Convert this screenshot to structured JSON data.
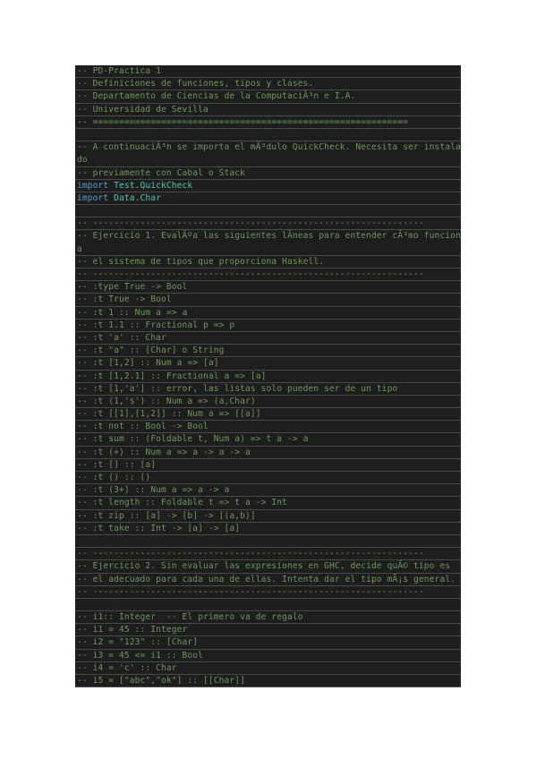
{
  "colors": {
    "background": "#1e1e1e",
    "comment": "#6a9955",
    "keyword": "#569cd6",
    "module": "#4ec9b0",
    "row_border": "#4a4a4a"
  },
  "lines": [
    {
      "kind": "comment",
      "text": "-- PD-Practica 1"
    },
    {
      "kind": "comment",
      "text": "-- Definiciones de funciones, tipos y clases."
    },
    {
      "kind": "comment",
      "text": "-- Departamento de Ciencias de la ComputaciÃ³n e I.A."
    },
    {
      "kind": "comment",
      "text": "-- Universidad de Sevilla"
    },
    {
      "kind": "comment",
      "text": "-- ============================================================"
    },
    {
      "kind": "blank",
      "text": ""
    },
    {
      "kind": "comment",
      "wrap": true,
      "text": "-- A continuaciÃ³n se importa el mÃ³dulo QuickCheck. Necesita ser instalado"
    },
    {
      "kind": "comment",
      "text": "-- previamente con Cabal o Stack"
    },
    {
      "kind": "import",
      "keyword": "import",
      "module": "Test.QuickCheck"
    },
    {
      "kind": "import",
      "keyword": "import",
      "module": "Data.Char"
    },
    {
      "kind": "blank",
      "text": ""
    },
    {
      "kind": "comment",
      "text": "-- ---------------------------------------------------------------"
    },
    {
      "kind": "comment",
      "wrap": true,
      "text": "-- Ejercicio 1. EvalÃºa las siguientes lÃ­neas para entender cÃ³mo funciona"
    },
    {
      "kind": "comment",
      "text": "-- el sistema de tipos que proporciona Haskell."
    },
    {
      "kind": "comment",
      "text": "-- ---------------------------------------------------------------"
    },
    {
      "kind": "comment",
      "text": "-- :type True -> Bool"
    },
    {
      "kind": "comment",
      "text": "-- :t True -> Bool"
    },
    {
      "kind": "comment",
      "text": "-- :t 1 :: Num a => a"
    },
    {
      "kind": "comment",
      "text": "-- :t 1.1 :: Fractional p => p"
    },
    {
      "kind": "comment",
      "text": "-- :t 'a' :: Char"
    },
    {
      "kind": "comment",
      "text": "-- :t \"a\" :: [Char] o String"
    },
    {
      "kind": "comment",
      "text": "-- :t [1,2] :: Num a => [a]"
    },
    {
      "kind": "comment",
      "text": "-- :t [1,2.1] :: Fractional a => [a]"
    },
    {
      "kind": "comment",
      "text": "-- :t [1,'a'] :: error, las listas solo pueden ser de un tipo"
    },
    {
      "kind": "comment",
      "text": "-- :t (1,'s') :: Num a => (a,Char)"
    },
    {
      "kind": "comment",
      "text": "-- :t [[1],[1,2]] :: Num a => [[a]]"
    },
    {
      "kind": "comment",
      "text": "-- :t not :: Bool -> Bool"
    },
    {
      "kind": "comment",
      "text": "-- :t sum :: (Foldable t, Num a) => t a -> a"
    },
    {
      "kind": "comment",
      "text": "-- :t (+) :: Num a => a -> a -> a"
    },
    {
      "kind": "comment",
      "text": "-- :t [] :: [a]"
    },
    {
      "kind": "comment",
      "text": "-- :t () :: ()"
    },
    {
      "kind": "comment",
      "text": "-- :t (3+) :: Num a => a -> a"
    },
    {
      "kind": "comment",
      "text": "-- :t length :: Foldable t => t a -> Int"
    },
    {
      "kind": "comment",
      "text": "-- :t zip :: [a] -> [b] -> [(a,b)]"
    },
    {
      "kind": "comment",
      "text": "-- :t take :: Int -> [a] -> [a]"
    },
    {
      "kind": "blank",
      "text": ""
    },
    {
      "kind": "comment",
      "text": "-- ---------------------------------------------------------------"
    },
    {
      "kind": "comment",
      "text": "-- Ejercicio 2. Sin evaluar las expresiones en GHC, decide quÃ© tipo es"
    },
    {
      "kind": "comment",
      "text": "-- el adecuado para cada una de ellas. Intenta dar el tipo mÃ¡s general."
    },
    {
      "kind": "comment",
      "text": "-- ---------------------------------------------------------------"
    },
    {
      "kind": "blank",
      "text": ""
    },
    {
      "kind": "comment",
      "text": "-- i1:: Integer  -- El primero va de regalo"
    },
    {
      "kind": "comment",
      "text": "-- i1 = 45 :: Integer"
    },
    {
      "kind": "comment",
      "text": "-- i2 = \"123\" :: [Char]"
    },
    {
      "kind": "comment",
      "text": "-- i3 = 45 <= i1 :: Bool"
    },
    {
      "kind": "comment",
      "text": "-- i4 = 'c' :: Char"
    },
    {
      "kind": "comment",
      "text": "-- i5 = [\"abc\",\"ok\"] :: [[Char]]"
    }
  ]
}
